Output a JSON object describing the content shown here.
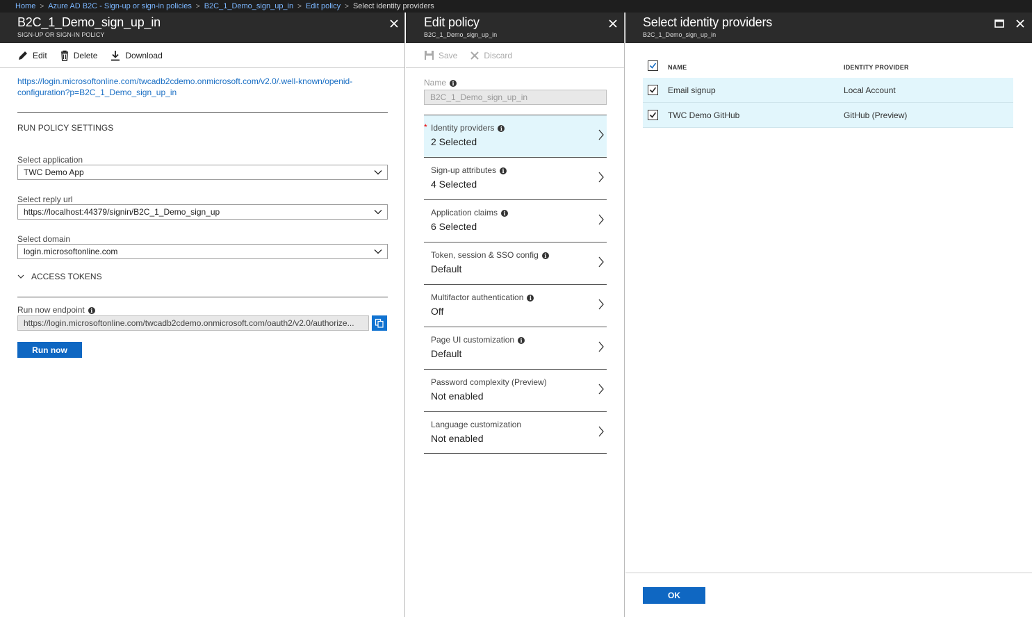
{
  "breadcrumb": {
    "items": [
      {
        "label": "Home"
      },
      {
        "label": "Azure AD B2C - Sign-up or sign-in policies"
      },
      {
        "label": "B2C_1_Demo_sign_up_in"
      },
      {
        "label": "Edit policy"
      },
      {
        "label": "Select identity providers"
      }
    ]
  },
  "blade1": {
    "title": "B2C_1_Demo_sign_up_in",
    "subtitle": "SIGN-UP OR SIGN-IN POLICY",
    "toolbar": {
      "edit": "Edit",
      "delete": "Delete",
      "download": "Download"
    },
    "config_link": "https://login.microsoftonline.com/twcadb2cdemo.onmicrosoft.com/v2.0/.well-known/openid-configuration?p=B2C_1_Demo_sign_up_in",
    "run_settings_title": "RUN POLICY SETTINGS",
    "select_application": {
      "label": "Select application",
      "value": "TWC Demo App"
    },
    "select_reply_url": {
      "label": "Select reply url",
      "value": "https://localhost:44379/signin/B2C_1_Demo_sign_up"
    },
    "select_domain": {
      "label": "Select domain",
      "value": "login.microsoftonline.com"
    },
    "access_tokens": "ACCESS TOKENS",
    "run_now_endpoint": {
      "label": "Run now endpoint",
      "value": "https://login.microsoftonline.com/twcadb2cdemo.onmicrosoft.com/oauth2/v2.0/authorize..."
    },
    "run_now_button": "Run now"
  },
  "blade2": {
    "title": "Edit policy",
    "subtitle": "B2C_1_Demo_sign_up_in",
    "toolbar": {
      "save": "Save",
      "discard": "Discard"
    },
    "name_label": "Name",
    "name_value": "B2C_1_Demo_sign_up_in",
    "items": [
      {
        "label": "Identity providers",
        "value": "2 Selected",
        "info": true
      },
      {
        "label": "Sign-up attributes",
        "value": "4 Selected",
        "info": true
      },
      {
        "label": "Application claims",
        "value": "6 Selected",
        "info": true
      },
      {
        "label": "Token, session & SSO config",
        "value": "Default",
        "info": true
      },
      {
        "label": "Multifactor authentication",
        "value": "Off",
        "info": true
      },
      {
        "label": "Page UI customization",
        "value": "Default",
        "info": true
      },
      {
        "label": "Password complexity (Preview)",
        "value": "Not enabled",
        "info": false
      },
      {
        "label": "Language customization",
        "value": "Not enabled",
        "info": false
      }
    ]
  },
  "blade3": {
    "title": "Select identity providers",
    "subtitle": "B2C_1_Demo_sign_up_in",
    "columns": {
      "name": "NAME",
      "provider": "IDENTITY PROVIDER"
    },
    "rows": [
      {
        "name": "Email signup",
        "provider": "Local Account",
        "checked": true
      },
      {
        "name": "TWC Demo GitHub",
        "provider": "GitHub (Preview)",
        "checked": true
      }
    ],
    "ok_button": "OK"
  },
  "colors": {
    "accent": "#0f67c2",
    "header_bg": "#2b2b2b",
    "selected_row": "#e2f6fc",
    "link": "#1a6fc4"
  }
}
